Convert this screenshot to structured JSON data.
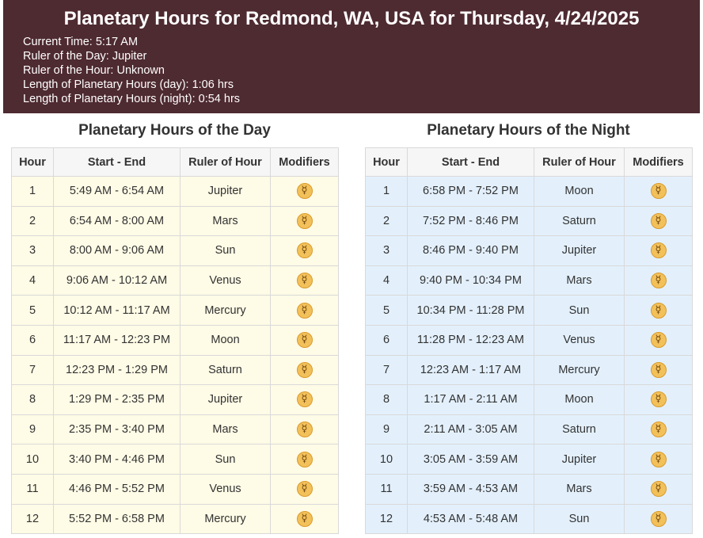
{
  "header": {
    "title": "Planetary Hours for Redmond, WA, USA for Thursday, 4/24/2025",
    "info": [
      "Current Time: 5:17 AM",
      "Ruler of the Day: Jupiter",
      "Ruler of the Hour: Unknown",
      "Length of Planetary Hours (day): 1:06 hrs",
      "Length of Planetary Hours (night): 0:54 hrs"
    ]
  },
  "columns": [
    "Hour",
    "Start - End",
    "Ruler of Hour",
    "Modifiers"
  ],
  "modifier_icon": "☿",
  "colors": {
    "header_bg": "#4e2a31",
    "day_row_bg": "#fefbe6",
    "night_row_bg": "#e3f0fc",
    "modifier_icon_bg": "#f3c15a"
  },
  "day": {
    "title": "Planetary Hours of the Day",
    "rows": [
      {
        "hour": "1",
        "range": "5:49 AM - 6:54 AM",
        "ruler": "Jupiter"
      },
      {
        "hour": "2",
        "range": "6:54 AM - 8:00 AM",
        "ruler": "Mars"
      },
      {
        "hour": "3",
        "range": "8:00 AM - 9:06 AM",
        "ruler": "Sun"
      },
      {
        "hour": "4",
        "range": "9:06 AM - 10:12 AM",
        "ruler": "Venus"
      },
      {
        "hour": "5",
        "range": "10:12 AM - 11:17 AM",
        "ruler": "Mercury"
      },
      {
        "hour": "6",
        "range": "11:17 AM - 12:23 PM",
        "ruler": "Moon"
      },
      {
        "hour": "7",
        "range": "12:23 PM - 1:29 PM",
        "ruler": "Saturn"
      },
      {
        "hour": "8",
        "range": "1:29 PM - 2:35 PM",
        "ruler": "Jupiter"
      },
      {
        "hour": "9",
        "range": "2:35 PM - 3:40 PM",
        "ruler": "Mars"
      },
      {
        "hour": "10",
        "range": "3:40 PM - 4:46 PM",
        "ruler": "Sun"
      },
      {
        "hour": "11",
        "range": "4:46 PM - 5:52 PM",
        "ruler": "Venus"
      },
      {
        "hour": "12",
        "range": "5:52 PM - 6:58 PM",
        "ruler": "Mercury"
      }
    ]
  },
  "night": {
    "title": "Planetary Hours of the Night",
    "rows": [
      {
        "hour": "1",
        "range": "6:58 PM - 7:52 PM",
        "ruler": "Moon"
      },
      {
        "hour": "2",
        "range": "7:52 PM - 8:46 PM",
        "ruler": "Saturn"
      },
      {
        "hour": "3",
        "range": "8:46 PM - 9:40 PM",
        "ruler": "Jupiter"
      },
      {
        "hour": "4",
        "range": "9:40 PM - 10:34 PM",
        "ruler": "Mars"
      },
      {
        "hour": "5",
        "range": "10:34 PM - 11:28 PM",
        "ruler": "Sun"
      },
      {
        "hour": "6",
        "range": "11:28 PM - 12:23 AM",
        "ruler": "Venus"
      },
      {
        "hour": "7",
        "range": "12:23 AM - 1:17 AM",
        "ruler": "Mercury"
      },
      {
        "hour": "8",
        "range": "1:17 AM - 2:11 AM",
        "ruler": "Moon"
      },
      {
        "hour": "9",
        "range": "2:11 AM - 3:05 AM",
        "ruler": "Saturn"
      },
      {
        "hour": "10",
        "range": "3:05 AM - 3:59 AM",
        "ruler": "Jupiter"
      },
      {
        "hour": "11",
        "range": "3:59 AM - 4:53 AM",
        "ruler": "Mars"
      },
      {
        "hour": "12",
        "range": "4:53 AM - 5:48 AM",
        "ruler": "Sun"
      }
    ]
  }
}
